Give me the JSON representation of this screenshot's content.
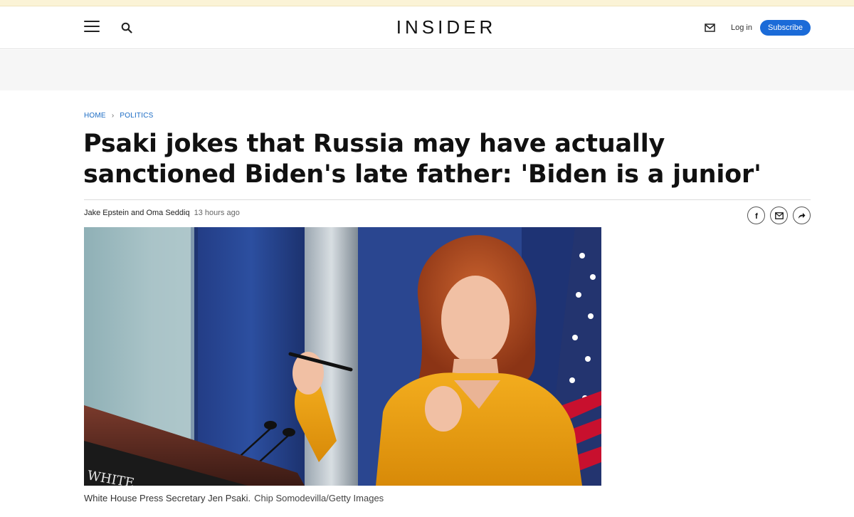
{
  "header": {
    "logo": "INSIDER",
    "login_label": "Log in",
    "subscribe_label": "Subscribe",
    "icons": [
      "menu-icon",
      "search-icon",
      "mail-icon"
    ]
  },
  "breadcrumb": {
    "home": "HOME",
    "section": "POLITICS"
  },
  "article": {
    "headline": "Psaki jokes that Russia may have actually sanctioned Biden's late father: 'Biden is a junior'",
    "authors": "Jake Epstein and Oma Seddiq",
    "timestamp": "13 hours ago",
    "share_icons": [
      "facebook-icon",
      "email-icon",
      "share-icon"
    ]
  },
  "photo": {
    "caption": "White House Press Secretary Jen Psaki.",
    "credit": "Chip Somodevilla/Getty Images",
    "podium_text": "WHITE"
  },
  "colors": {
    "accent": "#1b6bd8",
    "link": "#1a6bc4",
    "ad_band": "#f6f6f6"
  }
}
